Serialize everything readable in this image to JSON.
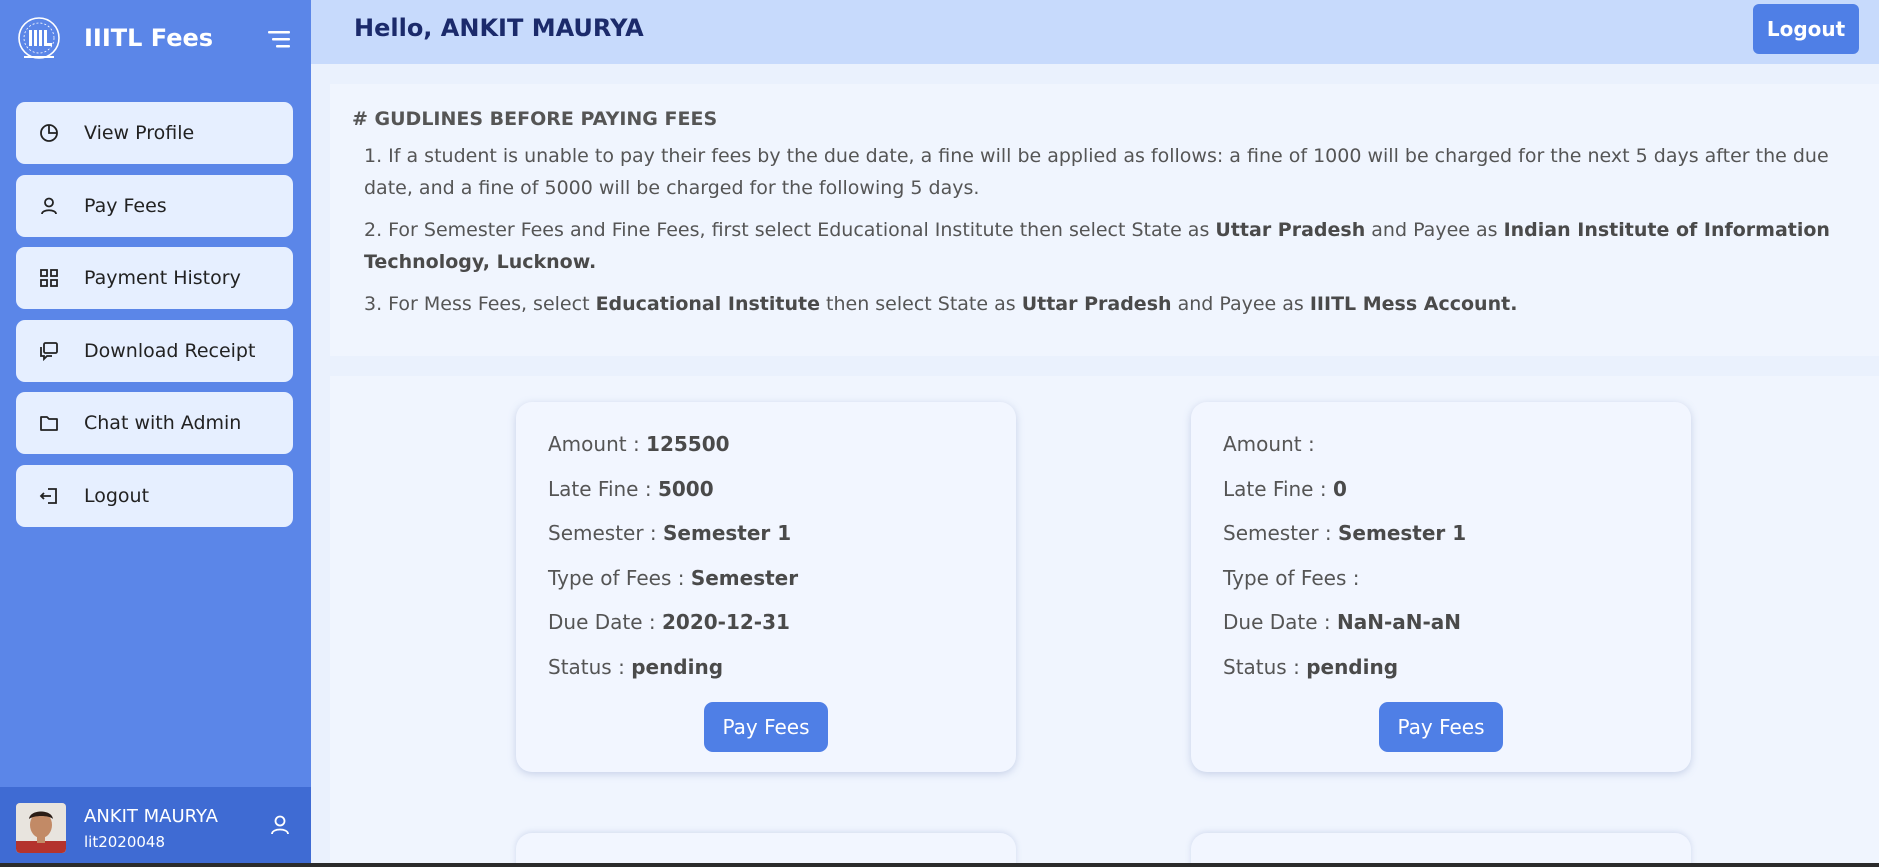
{
  "brand": {
    "title": "IIITL Fees"
  },
  "sidebar": {
    "items": [
      {
        "label": "View Profile",
        "icon": "pie-chart-icon"
      },
      {
        "label": "Pay Fees",
        "icon": "user-icon"
      },
      {
        "label": "Payment History",
        "icon": "grid-icon"
      },
      {
        "label": "Download Receipt",
        "icon": "chat-icon"
      },
      {
        "label": "Chat with Admin",
        "icon": "folder-icon"
      },
      {
        "label": "Logout",
        "icon": "logout-icon"
      }
    ],
    "user": {
      "name": "ANKIT MAURYA",
      "id": "lit2020048"
    }
  },
  "header": {
    "greeting": "Hello, ANKIT MAURYA",
    "logout_label": "Logout"
  },
  "guidelines": {
    "title": "# GUDLINES BEFORE PAYING FEES",
    "g1": "1. If a student is unable to pay their fees by the due date, a fine will be applied as follows: a fine of 1000 will be charged for the next 5 days after the due date, and a fine of 5000 will be charged for the following 5 days.",
    "g2_a": "2. For Semester Fees and Fine Fees, first select Educational Institute then select State as ",
    "g2_b": "Uttar Pradesh",
    "g2_c": " and Payee as ",
    "g2_d": "Indian Institute of Information Technology, Lucknow.",
    "g3_a": "3. For Mess Fees, select ",
    "g3_b": "Educational Institute",
    "g3_c": " then select State as ",
    "g3_d": "Uttar Pradesh",
    "g3_e": " and Payee as ",
    "g3_f": "IIITL Mess Account."
  },
  "labels": {
    "amount": "Amount : ",
    "late_fine": "Late Fine : ",
    "semester": "Semester : ",
    "type": "Type of Fees : ",
    "due_date": "Due Date : ",
    "status": "Status : ",
    "pay_button": "Pay Fees"
  },
  "fees": [
    {
      "amount": "125500",
      "late_fine": "5000",
      "semester": "Semester 1",
      "type": "Semester",
      "due_date": "2020-12-31",
      "status": "pending"
    },
    {
      "amount": "",
      "late_fine": "0",
      "semester": "Semester 1",
      "type": "",
      "due_date": "NaN-aN-aN",
      "status": "pending"
    }
  ],
  "colors": {
    "sidebar": "#5b86e8",
    "header": "#c7dafc",
    "accent": "#4f7fe6",
    "user_block": "#3f6bd3"
  }
}
